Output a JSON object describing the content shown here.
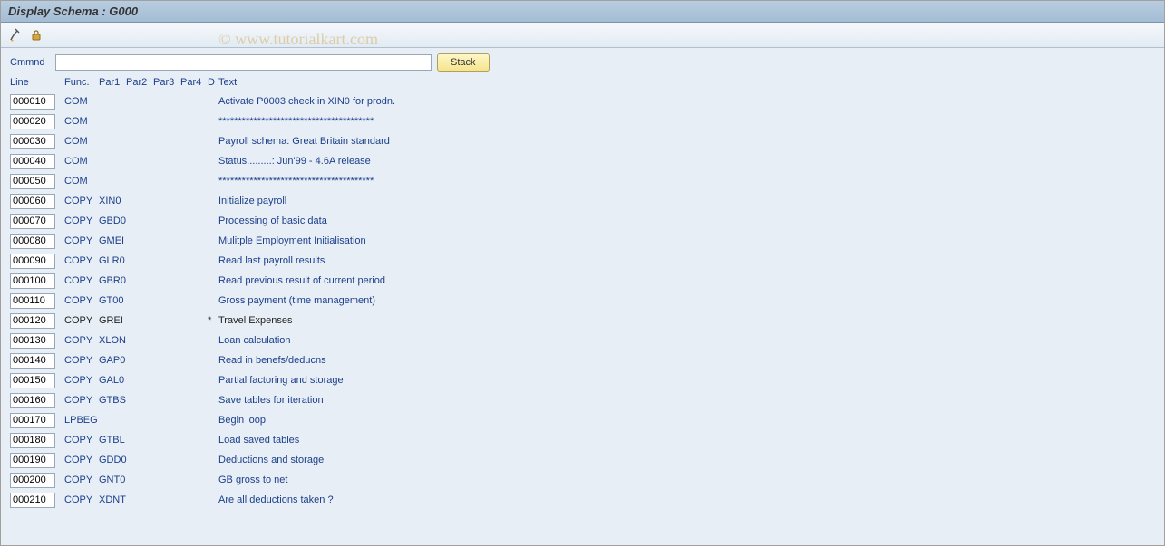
{
  "window": {
    "title": "Display Schema : G000"
  },
  "watermark": "© www.tutorialkart.com",
  "cmd": {
    "label": "Cmmnd",
    "value": "",
    "stack_label": "Stack"
  },
  "headers": {
    "line": "Line",
    "func": "Func.",
    "par1": "Par1",
    "par2": "Par2",
    "par3": "Par3",
    "par4": "Par4",
    "d": "D",
    "text": "Text"
  },
  "rows": [
    {
      "line": "000010",
      "func": "COM",
      "par1": "",
      "par2": "",
      "par3": "",
      "par4": "",
      "d": "",
      "text": "Activate P0003 check in XIN0 for prodn.",
      "black": false
    },
    {
      "line": "000020",
      "func": "COM",
      "par1": "",
      "par2": "",
      "par3": "",
      "par4": "",
      "d": "",
      "text": "****************************************",
      "black": false
    },
    {
      "line": "000030",
      "func": "COM",
      "par1": "",
      "par2": "",
      "par3": "",
      "par4": "",
      "d": "",
      "text": "Payroll schema: Great Britain standard",
      "black": false
    },
    {
      "line": "000040",
      "func": "COM",
      "par1": "",
      "par2": "",
      "par3": "",
      "par4": "",
      "d": "",
      "text": "Status.........: Jun'99 - 4.6A release",
      "black": false
    },
    {
      "line": "000050",
      "func": "COM",
      "par1": "",
      "par2": "",
      "par3": "",
      "par4": "",
      "d": "",
      "text": "****************************************",
      "black": false
    },
    {
      "line": "000060",
      "func": "COPY",
      "par1": "XIN0",
      "par2": "",
      "par3": "",
      "par4": "",
      "d": "",
      "text": "Initialize payroll",
      "black": false
    },
    {
      "line": "000070",
      "func": "COPY",
      "par1": "GBD0",
      "par2": "",
      "par3": "",
      "par4": "",
      "d": "",
      "text": "Processing of basic data",
      "black": false
    },
    {
      "line": "000080",
      "func": "COPY",
      "par1": "GMEI",
      "par2": "",
      "par3": "",
      "par4": "",
      "d": "",
      "text": "Mulitple Employment Initialisation",
      "black": false
    },
    {
      "line": "000090",
      "func": "COPY",
      "par1": "GLR0",
      "par2": "",
      "par3": "",
      "par4": "",
      "d": "",
      "text": "Read last payroll results",
      "black": false
    },
    {
      "line": "000100",
      "func": "COPY",
      "par1": "GBR0",
      "par2": "",
      "par3": "",
      "par4": "",
      "d": "",
      "text": "Read previous result of current period",
      "black": false
    },
    {
      "line": "000110",
      "func": "COPY",
      "par1": "GT00",
      "par2": "",
      "par3": "",
      "par4": "",
      "d": "",
      "text": "Gross payment (time management)",
      "black": false
    },
    {
      "line": "000120",
      "func": "COPY",
      "par1": "GREI",
      "par2": "",
      "par3": "",
      "par4": "",
      "d": "*",
      "text": "Travel Expenses",
      "black": true
    },
    {
      "line": "000130",
      "func": "COPY",
      "par1": "XLON",
      "par2": "",
      "par3": "",
      "par4": "",
      "d": "",
      "text": "Loan calculation",
      "black": false
    },
    {
      "line": "000140",
      "func": "COPY",
      "par1": "GAP0",
      "par2": "",
      "par3": "",
      "par4": "",
      "d": "",
      "text": "Read in benefs/deducns",
      "black": false
    },
    {
      "line": "000150",
      "func": "COPY",
      "par1": "GAL0",
      "par2": "",
      "par3": "",
      "par4": "",
      "d": "",
      "text": "Partial factoring and storage",
      "black": false
    },
    {
      "line": "000160",
      "func": "COPY",
      "par1": "GTBS",
      "par2": "",
      "par3": "",
      "par4": "",
      "d": "",
      "text": "Save tables for iteration",
      "black": false
    },
    {
      "line": "000170",
      "func": "LPBEG",
      "par1": "",
      "par2": "",
      "par3": "",
      "par4": "",
      "d": "",
      "text": "Begin loop",
      "black": false
    },
    {
      "line": "000180",
      "func": "COPY",
      "par1": "GTBL",
      "par2": "",
      "par3": "",
      "par4": "",
      "d": "",
      "text": "Load saved tables",
      "black": false
    },
    {
      "line": "000190",
      "func": "COPY",
      "par1": "GDD0",
      "par2": "",
      "par3": "",
      "par4": "",
      "d": "",
      "text": "Deductions and storage",
      "black": false
    },
    {
      "line": "000200",
      "func": "COPY",
      "par1": "GNT0",
      "par2": "",
      "par3": "",
      "par4": "",
      "d": "",
      "text": "GB gross to net",
      "black": false
    },
    {
      "line": "000210",
      "func": "COPY",
      "par1": "XDNT",
      "par2": "",
      "par3": "",
      "par4": "",
      "d": "",
      "text": "Are all deductions taken ?",
      "black": false
    }
  ]
}
